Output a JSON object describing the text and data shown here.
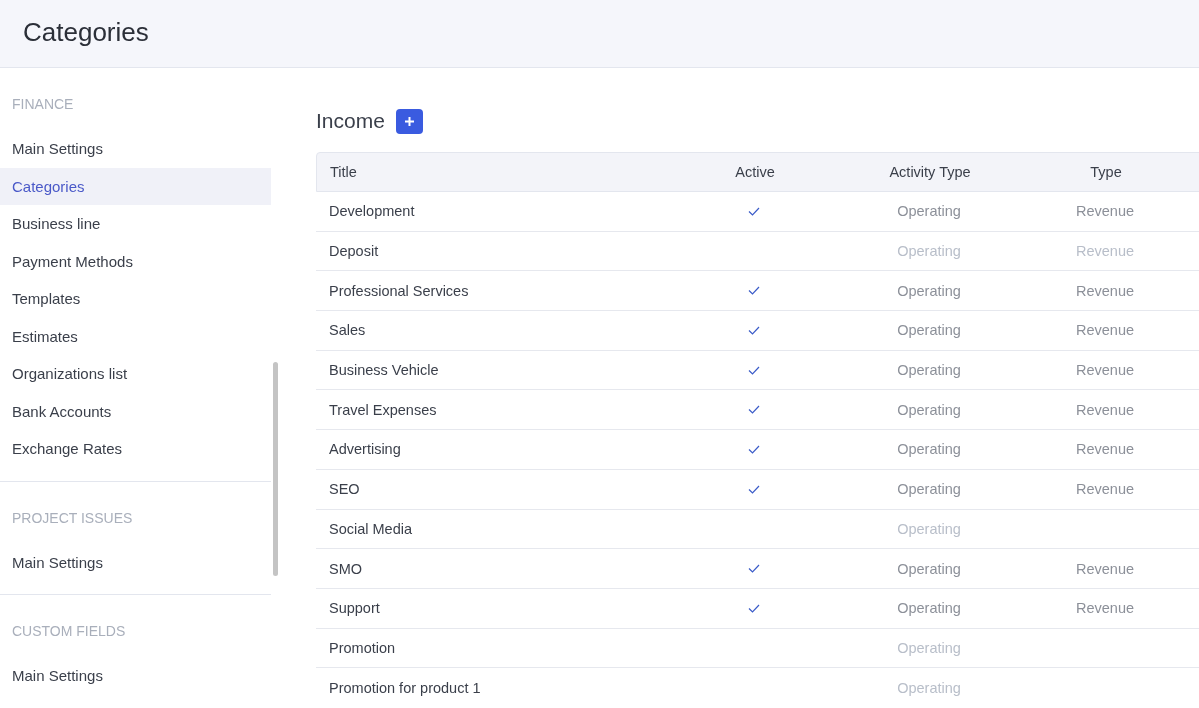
{
  "page": {
    "title": "Categories"
  },
  "sidebar": {
    "sections": [
      {
        "label": "FINANCE",
        "items": [
          {
            "label": "Main Settings",
            "selected": false
          },
          {
            "label": "Categories",
            "selected": true
          },
          {
            "label": "Business line",
            "selected": false
          },
          {
            "label": "Payment Methods",
            "selected": false
          },
          {
            "label": "Templates",
            "selected": false
          },
          {
            "label": "Estimates",
            "selected": false
          },
          {
            "label": "Organizations list",
            "selected": false
          },
          {
            "label": "Bank Accounts",
            "selected": false
          },
          {
            "label": "Exchange Rates",
            "selected": false
          }
        ]
      },
      {
        "label": "PROJECT ISSUES",
        "items": [
          {
            "label": "Main Settings",
            "selected": false
          }
        ]
      },
      {
        "label": "CUSTOM FIELDS",
        "items": [
          {
            "label": "Main Settings",
            "selected": false
          }
        ]
      }
    ]
  },
  "section": {
    "title": "Income"
  },
  "table": {
    "columns": [
      "Title",
      "Active",
      "Activity Type",
      "Type"
    ],
    "rows": [
      {
        "title": "Development",
        "active": true,
        "activity_type": "Operating",
        "type": "Revenue"
      },
      {
        "title": "Deposit",
        "active": false,
        "activity_type": "Operating",
        "type": "Revenue"
      },
      {
        "title": "Professional Services",
        "active": true,
        "activity_type": "Operating",
        "type": "Revenue"
      },
      {
        "title": "Sales",
        "active": true,
        "activity_type": "Operating",
        "type": "Revenue"
      },
      {
        "title": "Business Vehicle",
        "active": true,
        "activity_type": "Operating",
        "type": "Revenue"
      },
      {
        "title": "Travel Expenses",
        "active": true,
        "activity_type": "Operating",
        "type": "Revenue"
      },
      {
        "title": "Advertising",
        "active": true,
        "activity_type": "Operating",
        "type": "Revenue"
      },
      {
        "title": "SEO",
        "active": true,
        "activity_type": "Operating",
        "type": "Revenue"
      },
      {
        "title": "Social Media",
        "active": false,
        "activity_type": "Operating"
      },
      {
        "title": "SMO",
        "active": true,
        "activity_type": "Operating",
        "type": "Revenue"
      },
      {
        "title": "Support",
        "active": true,
        "activity_type": "Operating",
        "type": "Revenue"
      },
      {
        "title": "Promotion",
        "active": false,
        "activity_type": "Operating"
      },
      {
        "title": "Promotion for product 1",
        "active": false,
        "activity_type": "Operating"
      }
    ]
  }
}
